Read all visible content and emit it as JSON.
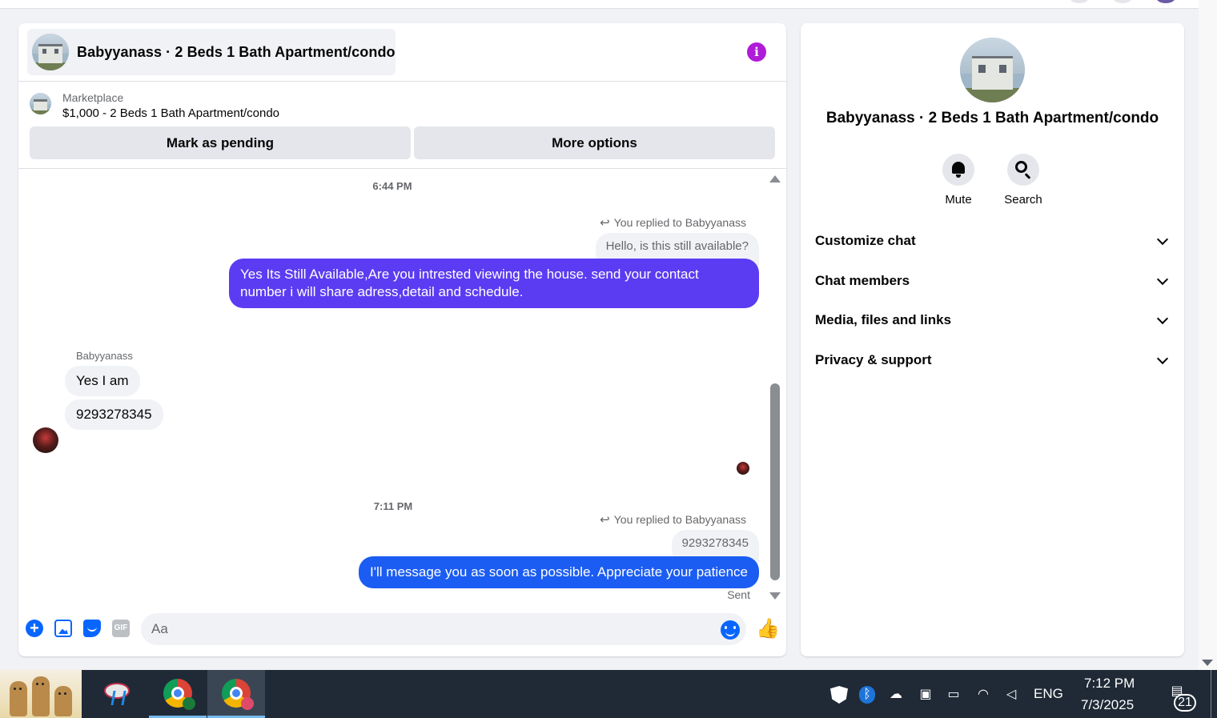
{
  "chat": {
    "title": "Babyyanass · 2 Beds 1 Bath Apartment/condo",
    "marketplace_label": "Marketplace",
    "listing": "$1,000 - 2 Beds 1 Bath Apartment/condo",
    "buttons": {
      "pending": "Mark as pending",
      "more": "More options"
    },
    "info_icon": "i",
    "messages": {
      "time1": "6:44 PM",
      "reply1_label": "You replied to Babyyanass",
      "quote1": "Hello, is this still available?",
      "out1": "Yes Its Still Available,Are you intrested viewing the house. send your contact number i will share adress,detail and schedule.",
      "sender": "Babyyanass",
      "in1": "Yes I am",
      "in2": "9293278345",
      "time2": "7:11 PM",
      "reply2_label": "You replied to Babyyanass",
      "quote2": "9293278345",
      "out2": "I'll message you as soon as possible. Appreciate your patience",
      "status": "Sent"
    },
    "composer": {
      "placeholder": "Aa",
      "gif_label": "GIF",
      "plus": "+",
      "like": "👍"
    },
    "colors": {
      "purple_bubble": "#5b3cf2",
      "blue_bubble": "#1b5cf2",
      "accent": "#0866ff"
    }
  },
  "side": {
    "title": "Babyyanass · 2 Beds 1 Bath Apartment/condo",
    "actions": {
      "mute": "Mute",
      "search": "Search"
    },
    "sections": [
      "Customize chat",
      "Chat members",
      "Media, files and links",
      "Privacy & support"
    ]
  },
  "taskbar": {
    "lang": "ENG",
    "time": "7:12 PM",
    "date": "7/3/2025",
    "notifications": "21",
    "tray_icons": [
      "shield-icon",
      "bluetooth-icon",
      "onedrive-icon",
      "meet-icon",
      "battery-icon",
      "wifi-icon",
      "volume-icon"
    ]
  }
}
